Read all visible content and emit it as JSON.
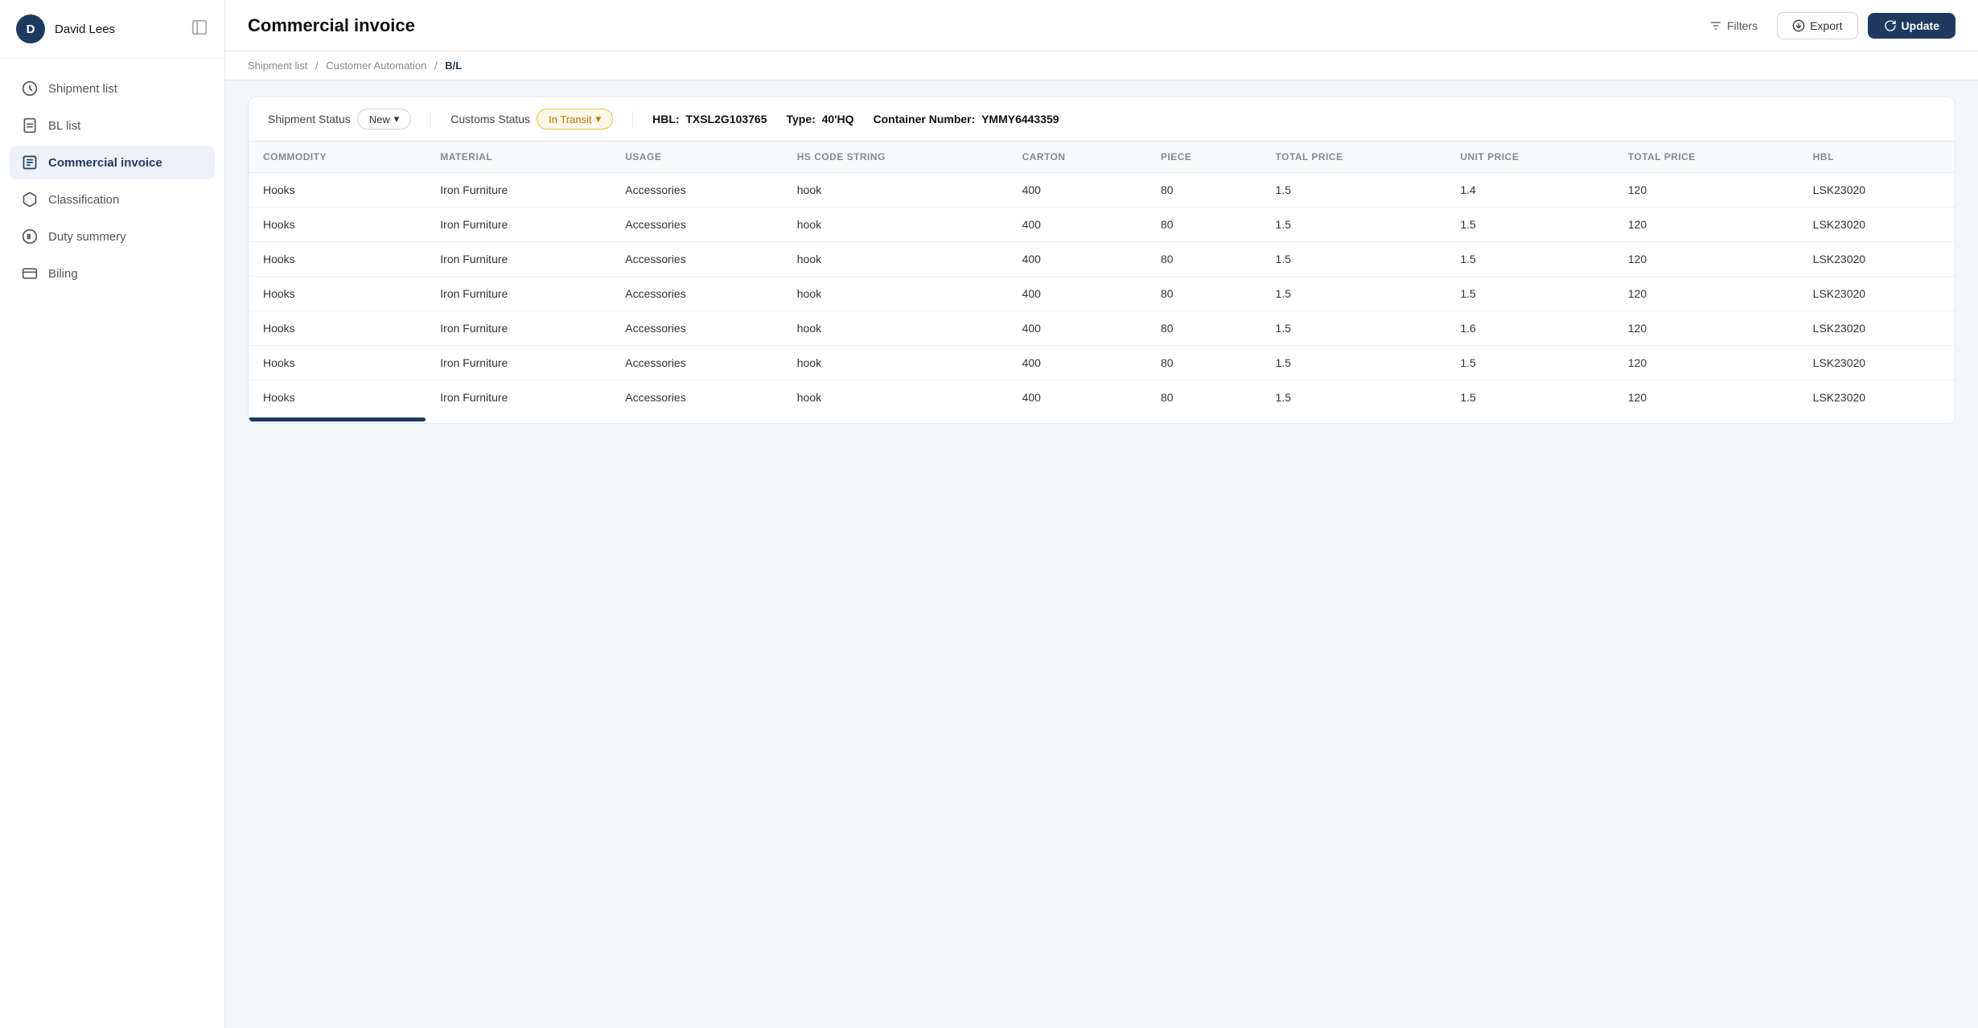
{
  "sidebar": {
    "user": {
      "initial": "D",
      "name": "David Lees"
    },
    "items": [
      {
        "id": "shipment-list",
        "label": "Shipment list",
        "icon": "shipment",
        "active": false
      },
      {
        "id": "bl-list",
        "label": "BL list",
        "icon": "bl",
        "active": false
      },
      {
        "id": "commercial-invoice",
        "label": "Commercial invoice",
        "icon": "invoice",
        "active": true
      },
      {
        "id": "classification",
        "label": "Classification",
        "icon": "classification",
        "active": false
      },
      {
        "id": "duty-summery",
        "label": "Duty summery",
        "icon": "duty",
        "active": false
      },
      {
        "id": "billing",
        "label": "Biling",
        "icon": "billing",
        "active": false
      }
    ]
  },
  "header": {
    "title": "Commercial invoice",
    "filters_label": "Filters",
    "export_label": "Export",
    "update_label": "Update"
  },
  "breadcrumb": {
    "items": [
      "Shipment list",
      "Customer Automation",
      "B/L"
    ]
  },
  "statusbar": {
    "shipment_status_label": "Shipment Status",
    "shipment_status_value": "New",
    "customs_status_label": "Customs Status",
    "customs_status_value": "In Transit",
    "hbl_label": "HBL:",
    "hbl_value": "TXSL2G103765",
    "type_label": "Type:",
    "type_value": "40'HQ",
    "container_label": "Container Number:",
    "container_value": "YMMY6443359"
  },
  "table": {
    "columns": [
      "COMMODITY",
      "MATERIAL",
      "USAGE",
      "HS CODE STRING",
      "CARTON",
      "PIECE",
      "TOTAL PRICE",
      "UNIT PRICE",
      "TOTAL PRICE",
      "HBL"
    ],
    "rows": [
      {
        "commodity": "Hooks",
        "material": "Iron Furniture",
        "usage": "Accessories",
        "hs_code": "hook",
        "carton": "400",
        "piece": "80",
        "total_price1": "1.5",
        "unit_price": "1.4",
        "total_price2": "120",
        "hbl": "LSK23020"
      },
      {
        "commodity": "Hooks",
        "material": "Iron Furniture",
        "usage": "Accessories",
        "hs_code": "hook",
        "carton": "400",
        "piece": "80",
        "total_price1": "1.5",
        "unit_price": "1.5",
        "total_price2": "120",
        "hbl": "LSK23020"
      },
      {
        "commodity": "Hooks",
        "material": "Iron Furniture",
        "usage": "Accessories",
        "hs_code": "hook",
        "carton": "400",
        "piece": "80",
        "total_price1": "1.5",
        "unit_price": "1.5",
        "total_price2": "120",
        "hbl": "LSK23020"
      },
      {
        "commodity": "Hooks",
        "material": "Iron Furniture",
        "usage": "Accessories",
        "hs_code": "hook",
        "carton": "400",
        "piece": "80",
        "total_price1": "1.5",
        "unit_price": "1.5",
        "total_price2": "120",
        "hbl": "LSK23020"
      },
      {
        "commodity": "Hooks",
        "material": "Iron Furniture",
        "usage": "Accessories",
        "hs_code": "hook",
        "carton": "400",
        "piece": "80",
        "total_price1": "1.5",
        "unit_price": "1.6",
        "total_price2": "120",
        "hbl": "LSK23020"
      },
      {
        "commodity": "Hooks",
        "material": "Iron Furniture",
        "usage": "Accessories",
        "hs_code": "hook",
        "carton": "400",
        "piece": "80",
        "total_price1": "1.5",
        "unit_price": "1.5",
        "total_price2": "120",
        "hbl": "LSK23020"
      },
      {
        "commodity": "Hooks",
        "material": "Iron Furniture",
        "usage": "Accessories",
        "hs_code": "hook",
        "carton": "400",
        "piece": "80",
        "total_price1": "1.5",
        "unit_price": "1.5",
        "total_price2": "120",
        "hbl": "LSK23020"
      }
    ]
  },
  "colors": {
    "accent": "#1e3a5f",
    "transit_bg": "#fff8e8",
    "transit_border": "#f0c040",
    "transit_text": "#b07a00"
  }
}
